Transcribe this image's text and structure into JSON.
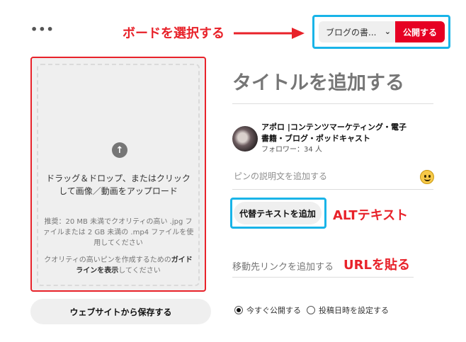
{
  "toolbar": {
    "more_label": "•••",
    "board_select_label": "ブログの書...",
    "publish_label": "公開する"
  },
  "annotations": {
    "board": "ボードを選択する",
    "alt": "ALTテキスト",
    "url": "URLを貼る",
    "color": "#e8222a",
    "highlight_color": "#19b4e8"
  },
  "upload": {
    "icon": "arrow-up-icon",
    "main_text": "ドラッグ＆ドロップ、またはクリックして画像／動画をアップロード",
    "requirements": "推奨：20 MB 未満でクオリティの高い .jpg ファイルまたは 2 GB 未満の .mp4 ファイルを使用してください",
    "guide_prefix": "クオリティの高いピンを作成するための",
    "guide_bold": "ガイドラインを表示",
    "guide_suffix": "してください",
    "save_from_web_label": "ウェブサイトから保存する"
  },
  "pin": {
    "title_placeholder": "タイトルを追加する",
    "author_name": "アポロ |コンテンツマーケティング・電子書籍・ブログ・ポッドキャスト",
    "followers": "フォロワー：34 人",
    "description_placeholder": "ピンの説明文を追加する",
    "alt_text_button": "代替テキストを追加",
    "link_placeholder": "移動先リンクを追加する"
  },
  "schedule": {
    "option_now": "今すぐ公開する",
    "option_later": "投稿日時を設定する",
    "selected": "option_now"
  },
  "colors": {
    "publish_red": "#e60023"
  }
}
